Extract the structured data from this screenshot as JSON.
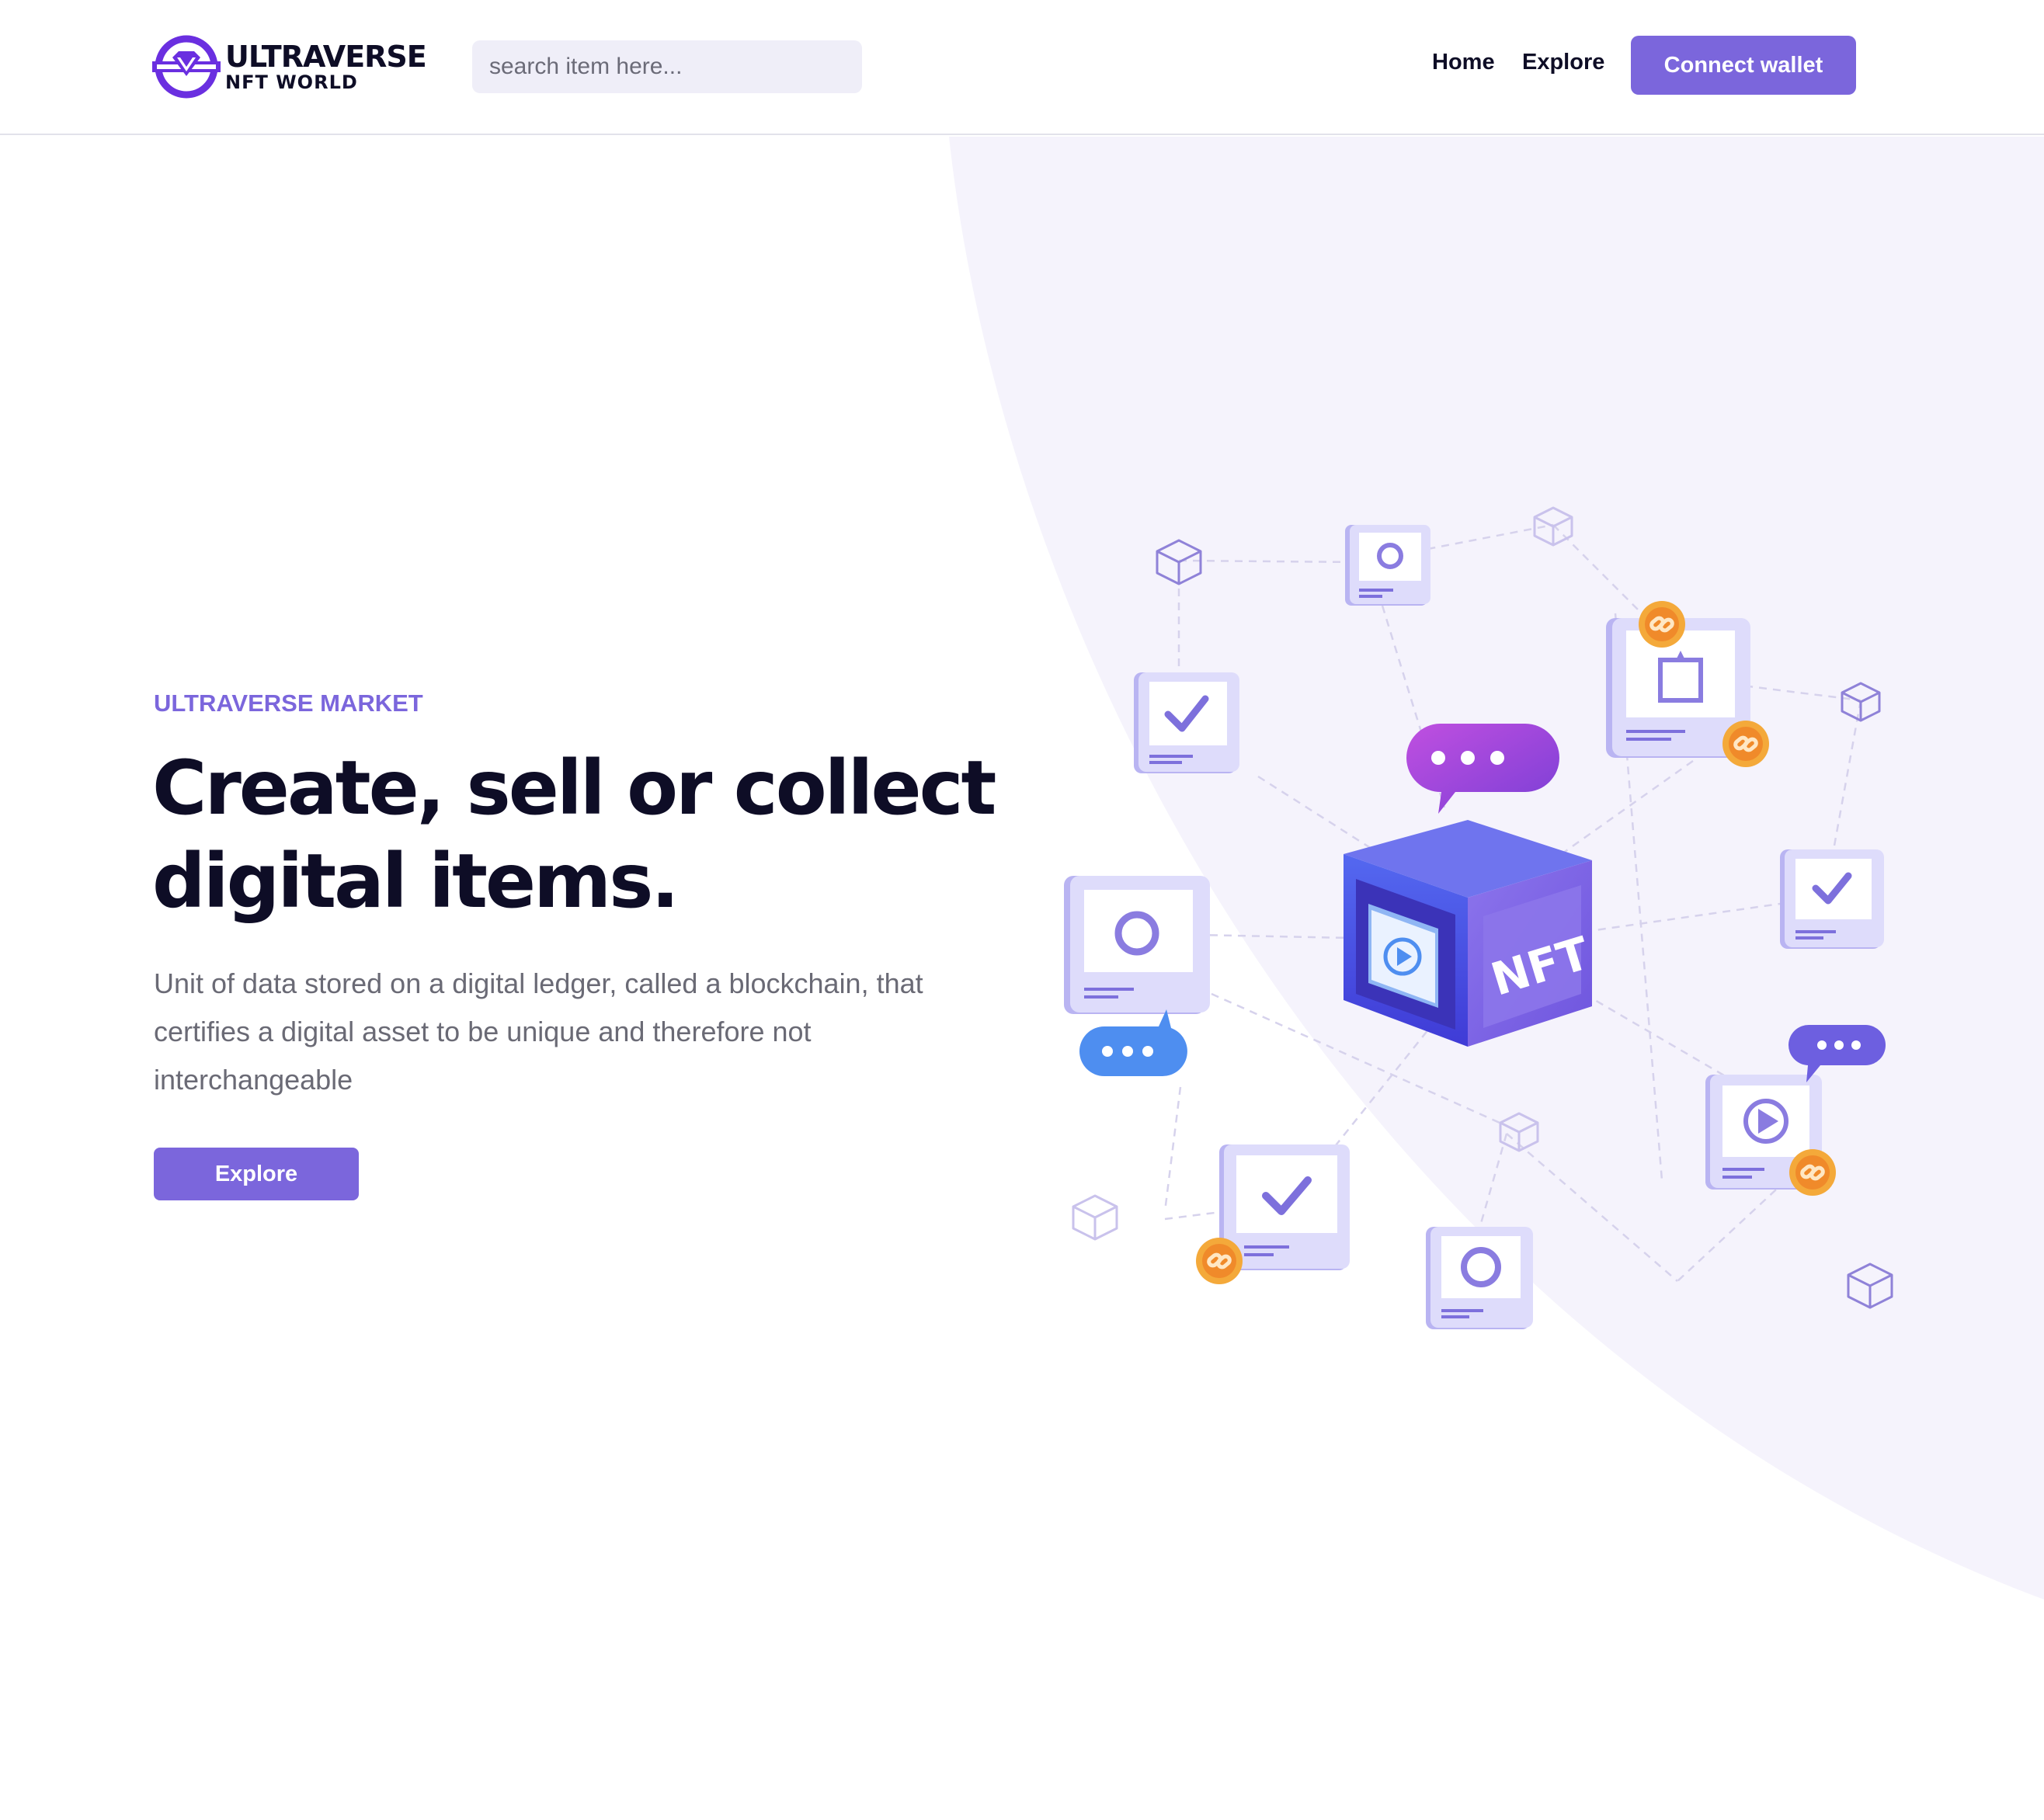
{
  "header": {
    "logo_title": "ULTRAVERSE",
    "logo_subtitle": "NFT WORLD",
    "search_placeholder": "search item here...",
    "nav": [
      "Home",
      "Explore"
    ],
    "connect_label": "Connect wallet"
  },
  "hero": {
    "eyebrow": "ULTRAVERSE MARKET",
    "headline": "Create, sell or collect digital items.",
    "description": "Unit of data stored on a digital ledger, called a blockchain, that certifies a digital asset to be unique and therefore not interchangeable",
    "explore_label": "Explore",
    "nft_label": "NFT"
  },
  "colors": {
    "accent": "#7b66dc",
    "dark": "#0e0d26",
    "curve": "#f5f3fc",
    "coin": "#f4a93a"
  }
}
